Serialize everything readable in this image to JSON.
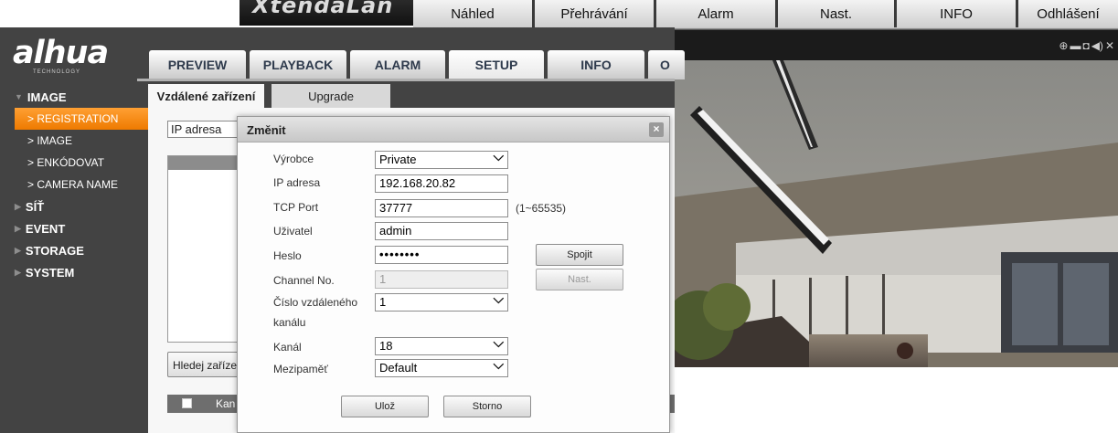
{
  "back_window": {
    "nav": [
      {
        "label": "Náhled"
      },
      {
        "label": "Přehrávání"
      },
      {
        "label": "Alarm"
      },
      {
        "label": "Nast."
      },
      {
        "label": "INFO"
      },
      {
        "label": "Odhlášení"
      }
    ]
  },
  "logo": {
    "text": "alhua",
    "tech": "TECHNOLOGY"
  },
  "top_tabs": [
    {
      "label": "PREVIEW"
    },
    {
      "label": "PLAYBACK"
    },
    {
      "label": "ALARM"
    },
    {
      "label": "SETUP"
    },
    {
      "label": "INFO"
    },
    {
      "label": "O"
    }
  ],
  "sidebar": {
    "image_group": "IMAGE",
    "items": [
      {
        "label": "> REGISTRATION"
      },
      {
        "label": "> IMAGE"
      },
      {
        "label": "> ENKÓDOVAT"
      },
      {
        "label": "> CAMERA NAME"
      }
    ],
    "groups": [
      {
        "label": "SÍŤ"
      },
      {
        "label": "EVENT"
      },
      {
        "label": "STORAGE"
      },
      {
        "label": "SYSTEM"
      }
    ]
  },
  "subtabs": {
    "active": "Vzdálené zařízení",
    "other": "Upgrade"
  },
  "filter": {
    "ip_select": "IP adresa"
  },
  "search_button": "Hledej zaříze",
  "table": {
    "header_partial": "Kan"
  },
  "modal": {
    "title": "Změnit",
    "close": "×",
    "fields": {
      "vyrobce": {
        "label": "Výrobce",
        "value": "Private"
      },
      "ip": {
        "label": "IP adresa",
        "value": "192.168.20.82"
      },
      "tcp": {
        "label": "TCP Port",
        "value": "37777",
        "range": "(1~65535)"
      },
      "user": {
        "label": "Uživatel",
        "value": "admin"
      },
      "pass": {
        "label": "Heslo",
        "value": "••••••••"
      },
      "channel_no": {
        "label": "Channel No.",
        "value": "1"
      },
      "remote_channel": {
        "label_line1": "Číslo vzdáleného",
        "label_line2": "kanálu",
        "value": "1"
      },
      "kanal": {
        "label": "Kanál",
        "value": "18"
      },
      "buffer": {
        "label": "Mezipaměť",
        "value": "Default"
      }
    },
    "connect_button": "Spojit",
    "set_button": "Nast.",
    "save_button": "Ulož",
    "cancel_button": "Storno"
  },
  "video": {
    "icons": [
      "zoom-icon",
      "record-icon",
      "snapshot-icon",
      "audio-icon",
      "close-icon"
    ]
  }
}
